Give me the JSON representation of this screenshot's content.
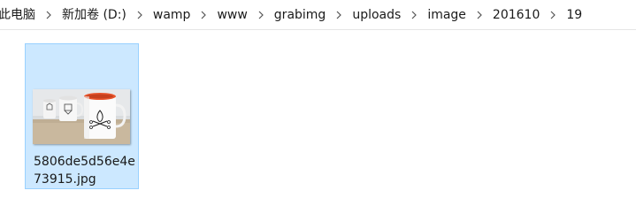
{
  "breadcrumb": {
    "items": [
      "此电脑",
      "新加卷 (D:)",
      "wamp",
      "www",
      "grabimg",
      "uploads",
      "image",
      "201610",
      "19"
    ],
    "separator_icon": "chevron-right-icon"
  },
  "files": [
    {
      "name": "5806de5d56e4e73915.jpg",
      "selected": true,
      "thumbnail": "mugs-photo-thumbnail"
    }
  ],
  "colors": {
    "selection_bg": "#cce8ff",
    "selection_border": "#99d1ff"
  }
}
